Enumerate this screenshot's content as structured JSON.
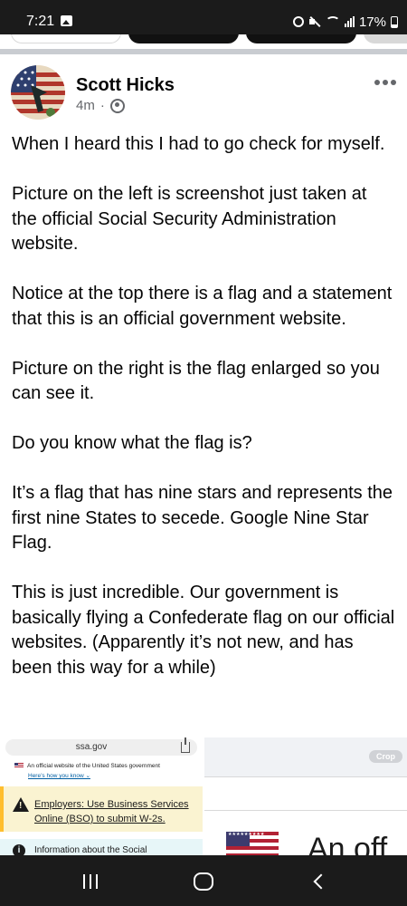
{
  "status_bar": {
    "time": "7:21",
    "battery": "17%",
    "icons": [
      "gallery-icon",
      "alarm-icon",
      "mute-icon",
      "wifi-icon",
      "signal-icon",
      "battery-icon"
    ]
  },
  "post": {
    "author": "Scott Hicks",
    "time_ago": "4m",
    "separator": "·",
    "audience_icon": "globe-icon",
    "paragraphs": [
      "When I heard this I had to go check for myself.",
      "Picture on the left is screenshot just taken at the official Social Security Administration website.",
      "Notice at the top there is a flag and a statement that this is an official government website.",
      "Picture on the right is the flag enlarged so you can see it.",
      "Do you know what the flag is?",
      "It’s a flag that has nine stars and represents the first nine States to secede.   Google Nine Star Flag.",
      "This is just incredible.  Our government is basically flying a Confederate flag on our official websites. (Apparently it’s not new, and has been this way for a while)"
    ]
  },
  "image_left": {
    "url": "ssa.gov",
    "gov_banner": "An official website of the United States government",
    "gov_link": "Here’s how you know ⌄",
    "alert": "Employers: Use Business Services Online (BSO) to submit W-2s.",
    "info": "Information about the Social",
    "info_icon_glyph": "i"
  },
  "image_right": {
    "crop_label": "Crop",
    "big_text": "An off",
    "flag_stars": "★★★★★★★★★"
  },
  "colors": {
    "status_bar_bg": "#1b1b1b",
    "alert_bg": "#faf3d1",
    "alert_border": "#ffbe2e",
    "link_blue": "#005ea2",
    "meta_gray": "#65676b"
  }
}
